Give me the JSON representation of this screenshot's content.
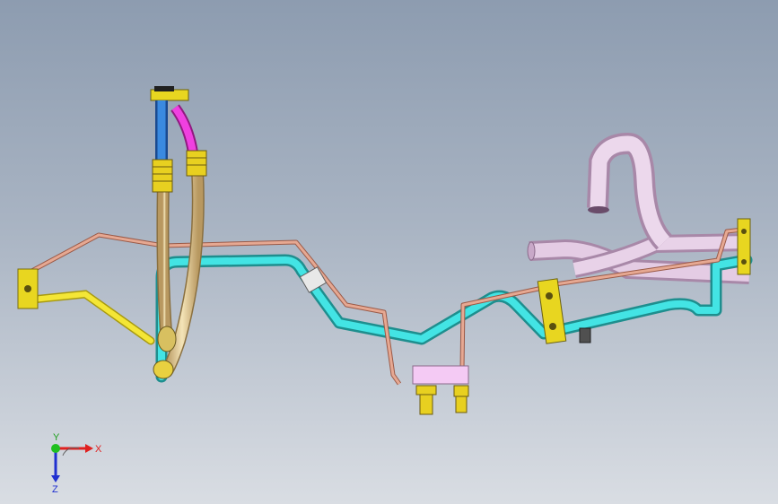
{
  "viewport": {
    "background_top": "#8d9cb0",
    "background_bottom": "#d9dde3"
  },
  "triad": {
    "x_label": "X",
    "y_label": "Y",
    "z_label": "Z",
    "x_color": "#e02020",
    "y_color": "#20c020",
    "z_color": "#2030d0"
  },
  "parts": {
    "yellow": "#f0e020",
    "cyan": "#35d8d8",
    "copper": "#d08a70",
    "tan": "#e6d2a0",
    "blue": "#2a70d0",
    "magenta": "#e020d0",
    "lavender": "#dcbcdc",
    "pink_block": "#f0c8f0"
  }
}
